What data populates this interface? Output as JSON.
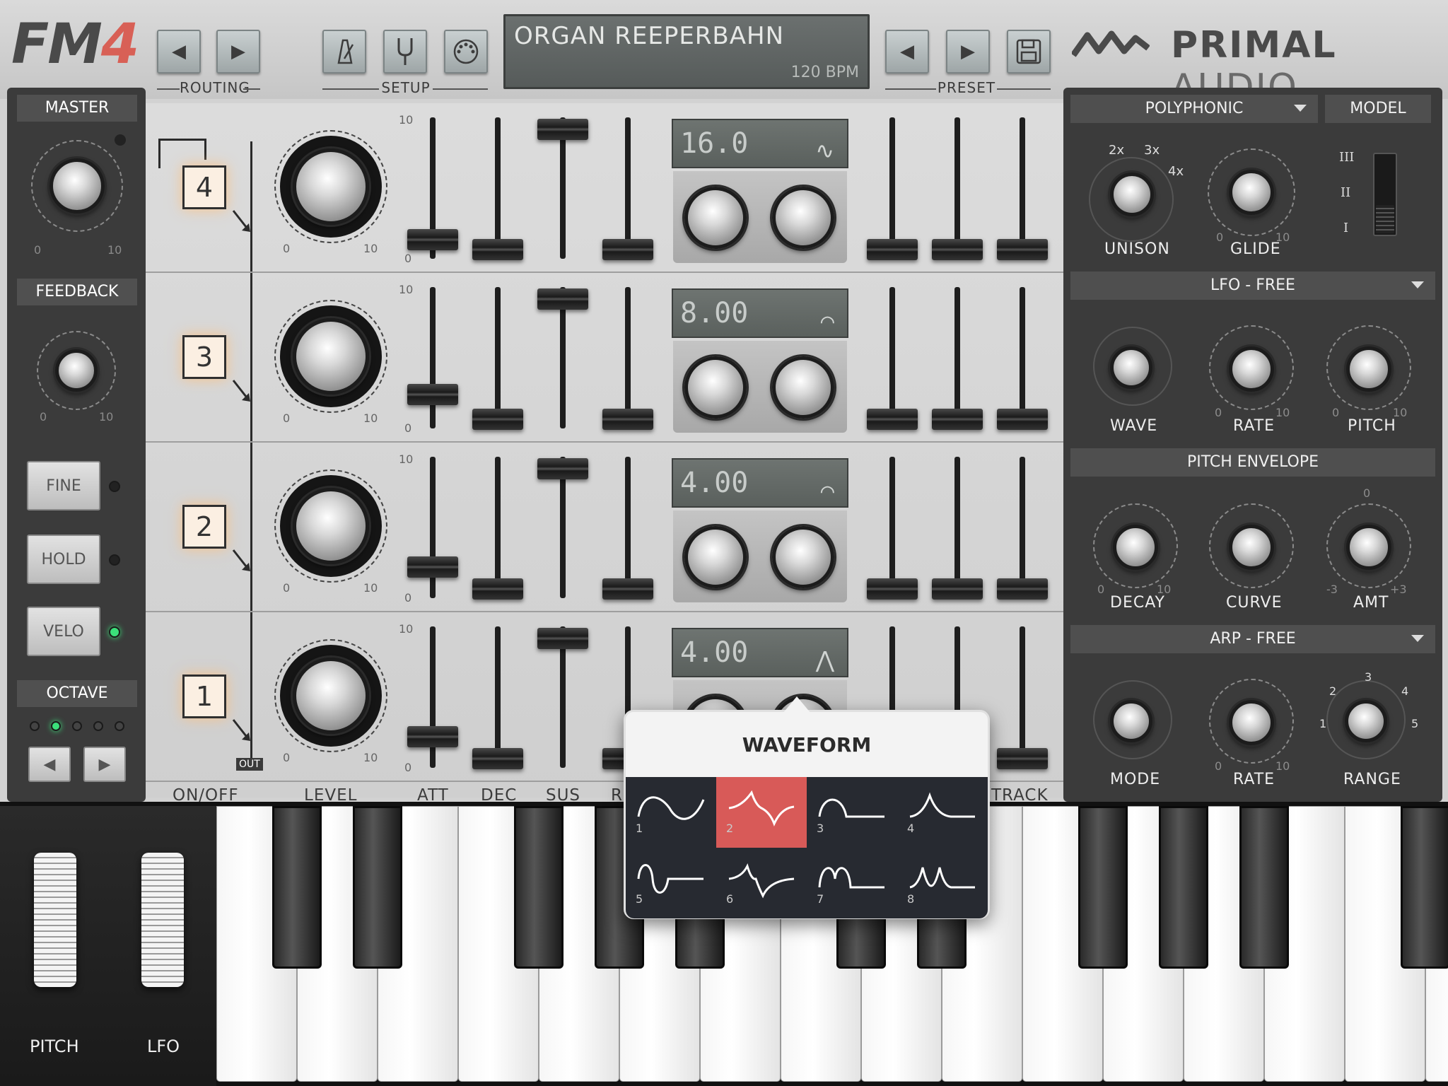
{
  "app": {
    "logo_text": "FM",
    "logo_num": "4",
    "brand_bold": "PRIMAL",
    "brand_light": "AUDIO"
  },
  "toolbar": {
    "routing_label": "ROUTING",
    "setup_label": "SETUP",
    "preset_label": "PRESET",
    "prev_icon": "◀",
    "next_icon": "▶"
  },
  "display": {
    "preset_name": "ORGAN REEPERBAHN",
    "bpm": "120 BPM"
  },
  "left": {
    "master": "MASTER",
    "feedback": "FEEDBACK",
    "min": "0",
    "max": "10",
    "fine": "FINE",
    "hold": "HOLD",
    "velo": "VELO",
    "octave": "OCTAVE",
    "velo_on": true,
    "octave_active_index": 1
  },
  "operators": [
    {
      "num": "4",
      "lfo_rate": "16.0",
      "lfo_wave": "∿"
    },
    {
      "num": "3",
      "lfo_rate": "8.00",
      "lfo_wave": "⌒"
    },
    {
      "num": "2",
      "lfo_rate": "4.00",
      "lfo_wave": "⌒"
    },
    {
      "num": "1",
      "lfo_rate": "4.00",
      "lfo_wave": "⋀"
    }
  ],
  "knob_range": {
    "min": "0",
    "max": "10"
  },
  "out_label": "OUT",
  "columns": {
    "onoff": "ON/OFF",
    "level": "LEVEL",
    "att": "ATT",
    "dec": "DEC",
    "sus": "SUS",
    "rel": "R",
    "track": "TRACK"
  },
  "right": {
    "poly": "POLYPHONIC",
    "model": "MODEL",
    "unison": "UNISON",
    "glide": "GLIDE",
    "unison_2x": "2x",
    "unison_3x": "3x",
    "unison_4x": "4x",
    "model_levels": [
      "III",
      "II",
      "I"
    ],
    "lfo_header": "LFO - FREE",
    "wave": "WAVE",
    "rate": "RATE",
    "pitch": "PITCH",
    "pitch_env": "PITCH ENVELOPE",
    "decay": "DECAY",
    "curve": "CURVE",
    "amt": "AMT",
    "amt_zero": "0",
    "amt_min": "-3",
    "amt_max": "+3",
    "arp_header": "ARP - FREE",
    "mode": "MODE",
    "range": "RANGE",
    "range_vals": [
      "1",
      "2",
      "3",
      "4",
      "5"
    ]
  },
  "wheels": {
    "pitch": "PITCH",
    "lfo": "LFO"
  },
  "waveform_popup": {
    "title": "WAVEFORM",
    "selected": 2,
    "options": [
      "1",
      "2",
      "3",
      "4",
      "5",
      "6",
      "7",
      "8"
    ]
  },
  "colors": {
    "accent_red": "#d85a58",
    "led_green": "#3be07a",
    "panel_dark": "#3b3b3b"
  }
}
